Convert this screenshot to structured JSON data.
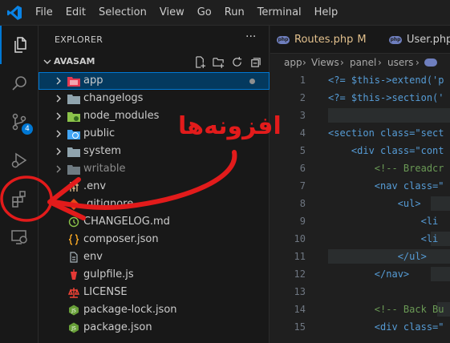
{
  "menu": [
    "File",
    "Edit",
    "Selection",
    "View",
    "Go",
    "Run",
    "Terminal",
    "Help"
  ],
  "explorer": {
    "title": "EXPLORER",
    "more": "···",
    "folder": "AVASAM",
    "items": [
      {
        "label": "app",
        "type": "folder"
      },
      {
        "label": "changelogs",
        "type": "folder"
      },
      {
        "label": "node_modules",
        "type": "folder"
      },
      {
        "label": "public",
        "type": "folder"
      },
      {
        "label": "system",
        "type": "folder"
      },
      {
        "label": "writable",
        "type": "folder"
      },
      {
        "label": ".env",
        "type": "file"
      },
      {
        "label": ".gitignore",
        "type": "file"
      },
      {
        "label": "CHANGELOG.md",
        "type": "file"
      },
      {
        "label": "composer.json",
        "type": "file"
      },
      {
        "label": "env",
        "type": "file"
      },
      {
        "label": "gulpfile.js",
        "type": "file"
      },
      {
        "label": "LICENSE",
        "type": "file"
      },
      {
        "label": "package-lock.json",
        "type": "file"
      },
      {
        "label": "package.json",
        "type": "file"
      }
    ]
  },
  "activity": {
    "source_control_badge": "4"
  },
  "tabs": [
    {
      "label": "Routes.php",
      "status": "M",
      "icon": "php"
    },
    {
      "label": "User.php",
      "icon": "php"
    }
  ],
  "breadcrumb": [
    "app",
    "Views",
    "panel",
    "users"
  ],
  "editor": {
    "line_numbers": [
      "1",
      "2",
      "3",
      "4",
      "5",
      "6",
      "7",
      "8",
      "9",
      "10",
      "11",
      "12",
      "13",
      "14",
      "15"
    ],
    "lines": [
      "<?= $this->extend('p",
      "<?= $this->section('",
      "",
      "<section class=\"sect",
      "    <div class=\"cont",
      "        <!-- Breadcr",
      "        <nav class=\"",
      "            <ul>",
      "                <li",
      "                <li",
      "            </ul>",
      "        </nav>",
      "",
      "        <!-- Back Bu",
      "        <div class=\""
    ]
  },
  "annotation": {
    "text": "افزونه‌ها",
    "color": "#e21b1b"
  },
  "colors": {
    "accent": "#0078d4",
    "annotation": "#e21b1b"
  }
}
